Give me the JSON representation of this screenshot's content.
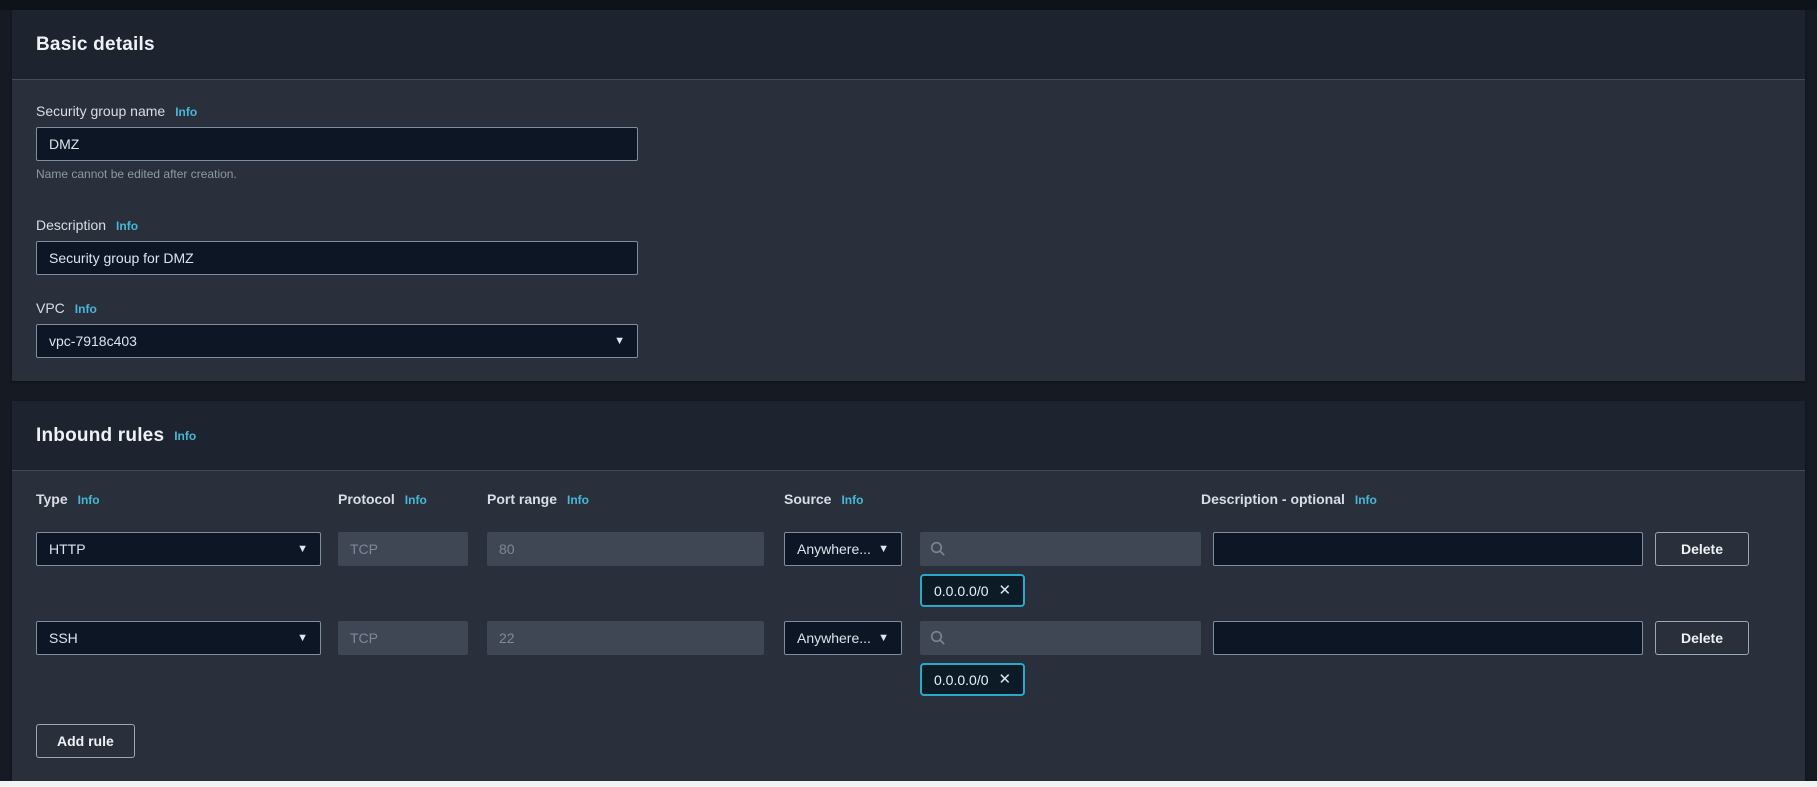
{
  "icons": {
    "chevron_down": "▼",
    "close": "✕",
    "search": "magnifier"
  },
  "colors": {
    "accent_info": "#44b9d6",
    "chip_border": "#2aa8c8",
    "page_bg": "#151a23",
    "card_header_bg": "#1d242f",
    "card_body_bg": "#2a303b",
    "input_bg": "#0c1624",
    "disabled_input_bg": "#404754"
  },
  "basic_details": {
    "title": "Basic details",
    "name_field": {
      "label": "Security group name",
      "info_label": "Info",
      "value": "DMZ",
      "helper": "Name cannot be edited after creation."
    },
    "description_field": {
      "label": "Description",
      "info_label": "Info",
      "value": "Security group for DMZ"
    },
    "vpc_field": {
      "label": "VPC",
      "info_label": "Info",
      "value": "vpc-7918c403"
    }
  },
  "inbound_rules": {
    "title": "Inbound rules",
    "info_label": "Info",
    "columns": [
      {
        "label": "Type",
        "info_label": "Info"
      },
      {
        "label": "Protocol",
        "info_label": "Info"
      },
      {
        "label": "Port range",
        "info_label": "Info"
      },
      {
        "label": "Source",
        "info_label": "Info"
      },
      {
        "label": "Description - optional",
        "info_label": "Info"
      }
    ],
    "rows": [
      {
        "type": "HTTP",
        "protocol_placeholder": "TCP",
        "port_placeholder": "80",
        "source": "Anywhere...",
        "source_chip": "0.0.0.0/0",
        "description_value": "",
        "delete_label": "Delete"
      },
      {
        "type": "SSH",
        "protocol_placeholder": "TCP",
        "port_placeholder": "22",
        "source": "Anywhere...",
        "source_chip": "0.0.0.0/0",
        "description_value": "",
        "delete_label": "Delete"
      }
    ],
    "add_rule_label": "Add rule"
  }
}
